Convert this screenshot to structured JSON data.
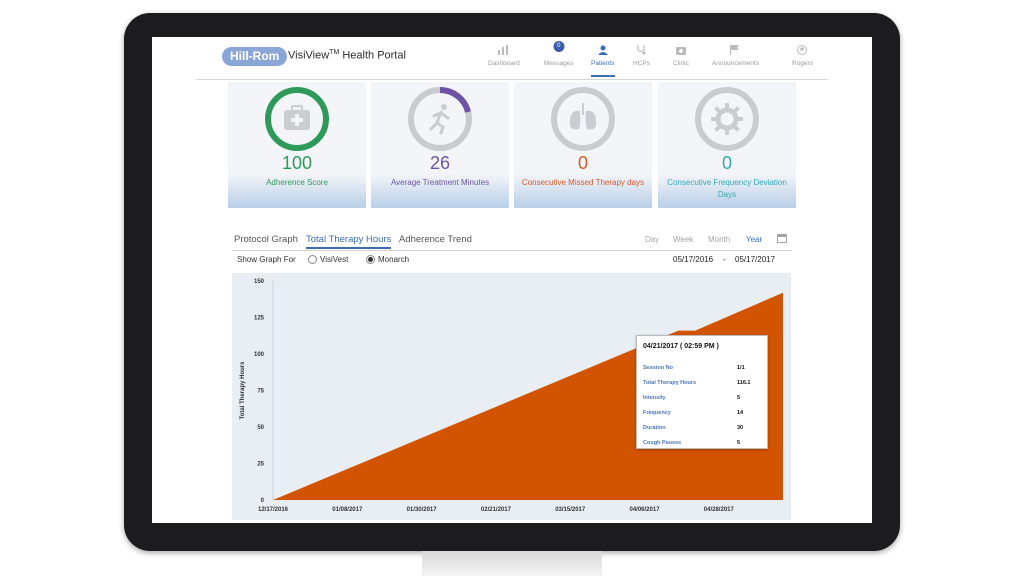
{
  "header": {
    "logo": "Hill-Rom",
    "title_main": "VisiView",
    "title_sup": "TM",
    "title_rest": " Health Portal",
    "nav": [
      {
        "label": "Dashboard",
        "icon": "bar-chart-icon"
      },
      {
        "label": "Messages",
        "icon": "message-icon",
        "badge": "0"
      },
      {
        "label": "Patients",
        "icon": "patient-icon",
        "active": true
      },
      {
        "label": "HCPs",
        "icon": "stethoscope-icon"
      },
      {
        "label": "Clinic",
        "icon": "clinic-icon"
      },
      {
        "label": "Announcements",
        "icon": "flag-icon"
      },
      {
        "label": "Rogers",
        "icon": "user-icon"
      }
    ]
  },
  "stats": [
    {
      "value": "100",
      "label": "Adherence Score",
      "color": "#2e9a5a",
      "icon": "medical-kit-icon"
    },
    {
      "value": "26",
      "label": "Average Treatment Minutes",
      "color": "#6e52a3",
      "icon": "runner-icon"
    },
    {
      "value": "0",
      "label": "Consecutive Missed Therapy days",
      "color": "#d9582b",
      "icon": "lungs-icon"
    },
    {
      "value": "0",
      "label": "Consecutive Frequency Deviation Days",
      "color": "#2fa8b8",
      "icon": "gear-icon"
    }
  ],
  "tabs": [
    "Protocol Graph",
    "Total Therapy Hours",
    "Adherence Trend"
  ],
  "active_tab": "Total Therapy Hours",
  "periods": [
    "Day",
    "Week",
    "Month",
    "Year"
  ],
  "active_period": "Year",
  "show_graph_for": {
    "label": "Show Graph For",
    "options": [
      "VisiVest",
      "Monarch"
    ],
    "selected": "Monarch"
  },
  "date_range": {
    "from": "05/17/2016",
    "sep": "-",
    "to": "05/17/2017"
  },
  "chart_data": {
    "type": "area",
    "ylabel": "Total Therapy Hours",
    "ylim": [
      0,
      150
    ],
    "yticks": [
      0,
      25,
      50,
      75,
      100,
      125,
      150
    ],
    "xticks": [
      "12/17/2016",
      "01/08/2017",
      "01/30/2017",
      "02/21/2017",
      "03/15/2017",
      "04/06/2017",
      "04/28/2017"
    ],
    "series_color": "#d35400",
    "points": [
      {
        "x": "12/17/2016",
        "y": 0
      },
      {
        "x": "04/16/2017",
        "y": 116
      },
      {
        "x": "04/21/2017",
        "y": 116
      },
      {
        "x": "05/17/2017",
        "y": 142
      }
    ]
  },
  "tooltip": {
    "title": "04/21/2017 ( 02:59 PM )",
    "rows": [
      {
        "label": "Session No",
        "value": "1/1"
      },
      {
        "label": "Total Therapy Hours",
        "value": "116.1"
      },
      {
        "label": "Intensity",
        "value": "5"
      },
      {
        "label": "Frequency",
        "value": "14"
      },
      {
        "label": "Duration",
        "value": "30"
      },
      {
        "label": "Cough Pauses",
        "value": "5"
      }
    ]
  }
}
